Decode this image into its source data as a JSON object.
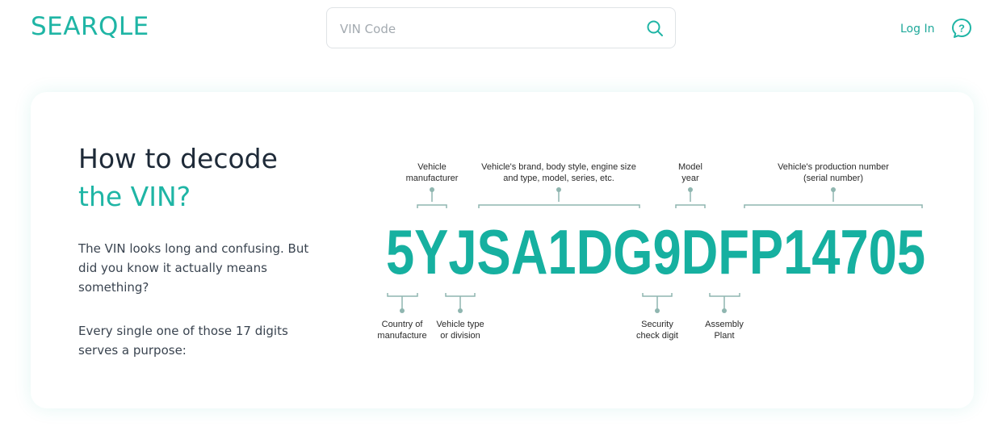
{
  "header": {
    "logo": "SEARQLE",
    "search_placeholder": "VIN Code",
    "login_label": "Log In"
  },
  "hero": {
    "title_line1": "How to decode",
    "title_line2": "the VIN?",
    "paragraph1": "The VIN looks long and confusing. But did you know it actually means something?",
    "paragraph2": "Every single one of those 17 digits serves a purpose:"
  },
  "diagram": {
    "vin": "5YJSA1DG9DFP14705",
    "top_labels": {
      "manufacturer": [
        "Vehicle",
        "manufacturer"
      ],
      "brand": [
        "Vehicle's brand, body style, engine size",
        "and type, model, series, etc."
      ],
      "model_year": [
        "Model",
        "year"
      ],
      "production": [
        "Vehicle's production number",
        "(serial number)"
      ]
    },
    "bottom_labels": {
      "country": [
        "Country of",
        "manufacture"
      ],
      "vehicle_type": [
        "Vehicle type",
        "or division"
      ],
      "security": [
        "Security",
        "check digit"
      ],
      "assembly": [
        "Assembly",
        "Plant"
      ]
    }
  },
  "colors": {
    "accent": "#1fb5a5",
    "vin": "#16b0a0",
    "title_dark": "#1e2a38",
    "bracket": "#8fb6b0"
  },
  "icons": {
    "search": "search-icon",
    "help": "help-icon"
  }
}
